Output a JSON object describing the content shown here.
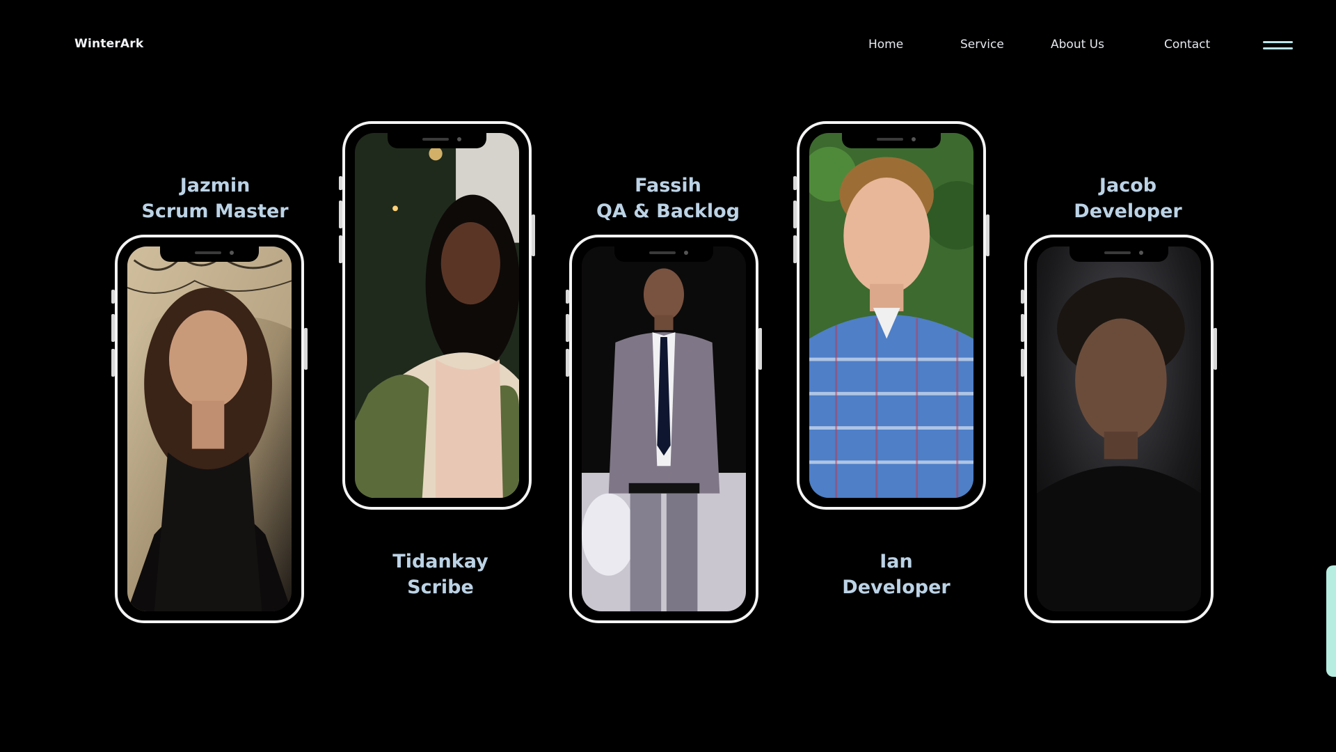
{
  "header": {
    "brand": "WinterArk",
    "nav": [
      {
        "label": "Home"
      },
      {
        "label": "Service"
      },
      {
        "label": "About Us"
      },
      {
        "label": "Contact"
      }
    ]
  },
  "team": [
    {
      "name": "Jazmin",
      "role": "Scrum Master"
    },
    {
      "name": "Tidankay",
      "role": "Scribe"
    },
    {
      "name": "Fassih",
      "role": "QA & Backlog"
    },
    {
      "name": "Ian",
      "role": "Developer"
    },
    {
      "name": "Jacob",
      "role": "Developer"
    }
  ],
  "colors": {
    "background": "#000000",
    "name_text": "#bcd3e6",
    "phone_frame": "#f4f4f4",
    "menu_icon": "#b9e4ea",
    "scroll_handle": "#b7ece0"
  },
  "icons": {
    "menu": "hamburger-menu-icon"
  }
}
